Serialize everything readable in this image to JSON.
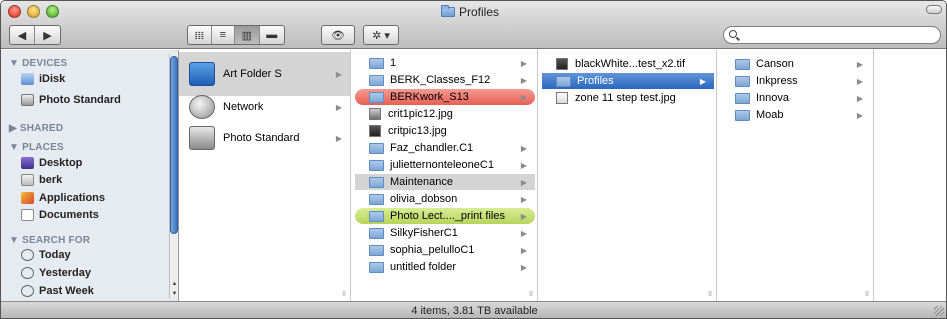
{
  "window": {
    "title": "Profiles"
  },
  "toolbar": {
    "back_label": "◀",
    "forward_label": "▶",
    "view_icons": "𝍖",
    "view_list": "≡",
    "view_columns": "▥",
    "view_coverflow": "▬",
    "quicklook_label": "👁",
    "action_label": "✲ ▾",
    "search_placeholder": ""
  },
  "sidebar": {
    "sections": [
      {
        "title": "▼ DEVICES",
        "items": [
          "iDisk",
          "Photo Standard"
        ]
      },
      {
        "title": "▶ SHARED",
        "items": []
      },
      {
        "title": "▼ PLACES",
        "items": [
          "Desktop",
          "berk",
          "Applications",
          "Documents"
        ]
      },
      {
        "title": "▼ SEARCH FOR",
        "items": [
          "Today",
          "Yesterday",
          "Past Week"
        ]
      }
    ]
  },
  "columns": [
    {
      "items": [
        {
          "label": "Art Folder S",
          "type": "share",
          "has_children": true,
          "state": "selected-gray"
        },
        {
          "label": "Network",
          "type": "network",
          "has_children": true,
          "state": ""
        },
        {
          "label": "Photo Standard",
          "type": "disk",
          "has_children": true,
          "state": ""
        }
      ]
    },
    {
      "items": [
        {
          "label": "1",
          "type": "folder",
          "has_children": true,
          "state": ""
        },
        {
          "label": "BERK_Classes_F12",
          "type": "folder",
          "has_children": true,
          "state": ""
        },
        {
          "label": "BERKwork_S13",
          "type": "folder",
          "has_children": true,
          "state": "label-red"
        },
        {
          "label": "crit1pic12.jpg",
          "type": "file-pic",
          "has_children": false,
          "state": ""
        },
        {
          "label": "critpic13.jpg",
          "type": "file-dark",
          "has_children": false,
          "state": ""
        },
        {
          "label": "Faz_chandler.C1",
          "type": "folder",
          "has_children": true,
          "state": ""
        },
        {
          "label": "julietternonteleoneC1",
          "type": "folder",
          "has_children": true,
          "state": ""
        },
        {
          "label": "Maintenance",
          "type": "folder",
          "has_children": true,
          "state": "selected-gray"
        },
        {
          "label": "olivia_dobson",
          "type": "folder",
          "has_children": true,
          "state": ""
        },
        {
          "label": "Photo Lect...._print files",
          "type": "folder",
          "has_children": true,
          "state": "label-green"
        },
        {
          "label": "SilkyFisherC1",
          "type": "folder",
          "has_children": true,
          "state": ""
        },
        {
          "label": "sophia_pelulloC1",
          "type": "folder",
          "has_children": true,
          "state": ""
        },
        {
          "label": "untitled folder",
          "type": "folder",
          "has_children": true,
          "state": ""
        }
      ]
    },
    {
      "items": [
        {
          "label": "blackWhite...test_x2.tif",
          "type": "file-dark",
          "has_children": false,
          "state": ""
        },
        {
          "label": "Profiles",
          "type": "folder",
          "has_children": true,
          "state": "selected-blue"
        },
        {
          "label": "zone 11 step test.jpg",
          "type": "file",
          "has_children": false,
          "state": ""
        }
      ]
    },
    {
      "items": [
        {
          "label": "Canson",
          "type": "folder",
          "has_children": true,
          "state": ""
        },
        {
          "label": "Inkpress",
          "type": "folder",
          "has_children": true,
          "state": ""
        },
        {
          "label": "Innova",
          "type": "folder",
          "has_children": true,
          "state": ""
        },
        {
          "label": "Moab",
          "type": "folder",
          "has_children": true,
          "state": ""
        }
      ]
    }
  ],
  "status": {
    "text": "4 items, 3.81 TB available"
  }
}
